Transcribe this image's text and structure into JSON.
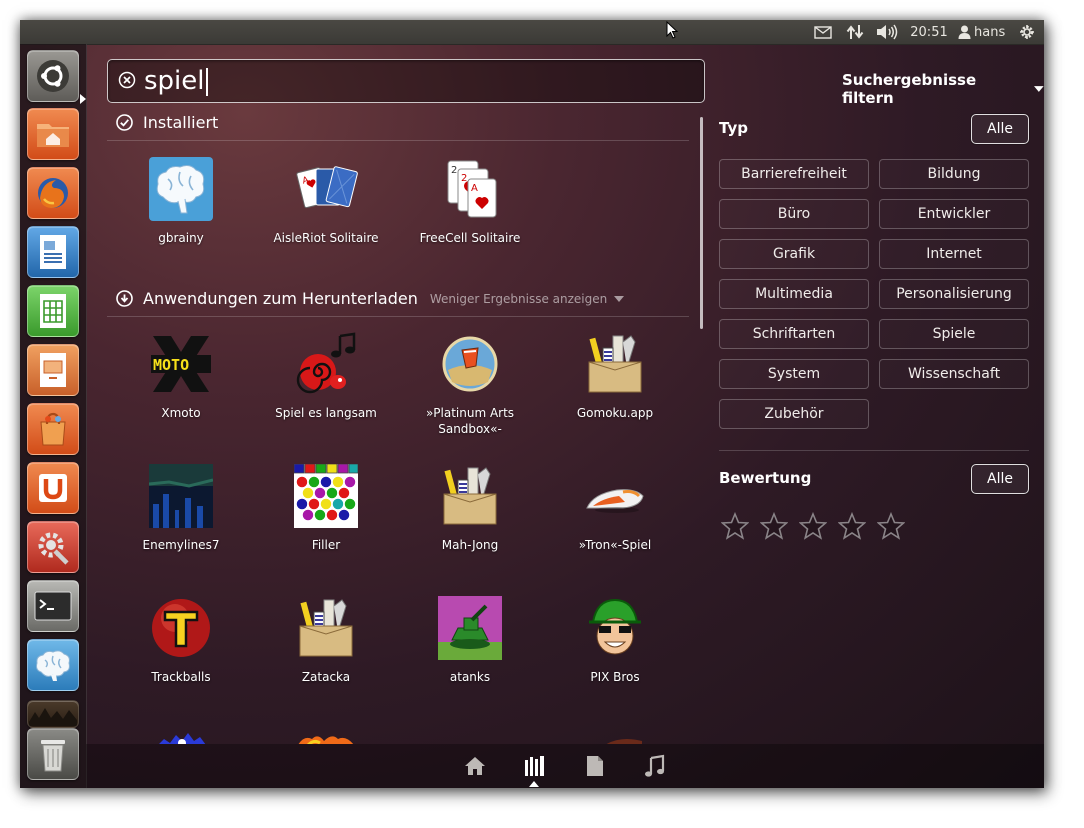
{
  "top_panel": {
    "clock": "20:51",
    "user": "hans",
    "indicators": [
      "mail-icon",
      "network-icon",
      "volume-icon",
      "user-icon",
      "session-gear-icon"
    ]
  },
  "launcher": {
    "items": [
      {
        "name": "dash-home",
        "icon": "ubuntu-logo-icon"
      },
      {
        "name": "home-folder",
        "icon": "folder-home-icon"
      },
      {
        "name": "firefox",
        "icon": "firefox-icon"
      },
      {
        "name": "libreoffice-writer",
        "icon": "writer-icon"
      },
      {
        "name": "libreoffice-calc",
        "icon": "calc-icon"
      },
      {
        "name": "libreoffice-impress",
        "icon": "impress-icon"
      },
      {
        "name": "ubuntu-software-center",
        "icon": "software-center-icon"
      },
      {
        "name": "ubuntu-one",
        "icon": "ubuntu-one-icon"
      },
      {
        "name": "system-settings",
        "icon": "settings-icon"
      },
      {
        "name": "terminal",
        "icon": "terminal-icon"
      },
      {
        "name": "gbrainy",
        "icon": "gbrainy-icon"
      },
      {
        "name": "workspace-switcher",
        "icon": "workspaces-icon"
      },
      {
        "name": "trash",
        "icon": "trash-icon"
      }
    ]
  },
  "search": {
    "query": "spiel",
    "clear_icon": "clear-search-icon"
  },
  "installed": {
    "header": "Installiert",
    "apps": [
      {
        "name": "gbrainy",
        "label": "gbrainy",
        "icon": "gbrainy-icon"
      },
      {
        "name": "aisleriot",
        "label": "AisleRiot Solitaire",
        "icon": "playing-cards-icon"
      },
      {
        "name": "freecell",
        "label": "FreeCell Solitaire",
        "icon": "freecell-cards-icon"
      }
    ]
  },
  "download": {
    "header": "Anwendungen zum Herunterladen",
    "less_results": "Weniger Ergebnisse anzeigen",
    "apps": [
      {
        "name": "xmoto",
        "label": "Xmoto",
        "icon": "xmoto-icon"
      },
      {
        "name": "spiel-es-langsam",
        "label": "Spiel es langsam",
        "icon": "snail-music-icon"
      },
      {
        "name": "platinum-arts",
        "label": "»Platinum Arts Sandbox«-",
        "icon": "sandbox-icon"
      },
      {
        "name": "gomoku",
        "label": "Gomoku.app",
        "icon": "package-box-icon"
      },
      {
        "name": "enemylines7",
        "label": "Enemylines7",
        "icon": "enemylines-icon"
      },
      {
        "name": "filler",
        "label": "Filler",
        "icon": "filler-icon"
      },
      {
        "name": "mah-jong",
        "label": "Mah-Jong",
        "icon": "package-box-icon"
      },
      {
        "name": "tron-spiel",
        "label": "»Tron«-Spiel",
        "icon": "tron-bike-icon"
      },
      {
        "name": "trackballs",
        "label": "Trackballs",
        "icon": "trackballs-icon"
      },
      {
        "name": "zatacka",
        "label": "Zatacka",
        "icon": "package-box-icon"
      },
      {
        "name": "atanks",
        "label": "atanks",
        "icon": "atanks-icon"
      },
      {
        "name": "pix-bros",
        "label": "PIX Bros",
        "icon": "pix-bros-icon"
      }
    ]
  },
  "filters": {
    "title": "Suchergebnisse filtern",
    "type": {
      "title": "Typ",
      "all": "Alle",
      "categories": [
        "Barrierefreiheit",
        "Bildung",
        "Büro",
        "Entwickler",
        "Grafik",
        "Internet",
        "Multimedia",
        "Personalisierung",
        "Schriftarten",
        "Spiele",
        "System",
        "Wissenschaft",
        "Zubehör"
      ]
    },
    "rating": {
      "title": "Bewertung",
      "all": "Alle",
      "stars": 5
    }
  },
  "lenses": [
    "home-lens-icon",
    "applications-lens-icon",
    "files-lens-icon",
    "music-lens-icon"
  ],
  "colors": {
    "orange": "#e5622a",
    "background_dark": "#2e1a25"
  }
}
